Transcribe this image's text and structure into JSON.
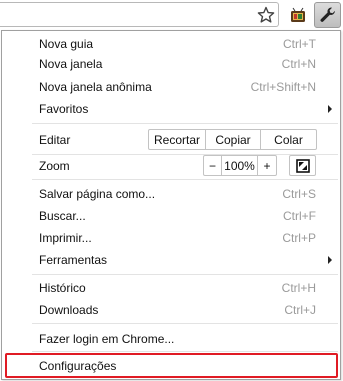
{
  "icons": {
    "star": "star-icon",
    "extension": "extension-icon",
    "wrench": "wrench-icon",
    "fullscreen": "fullscreen-icon"
  },
  "colors": {
    "highlight": "#e01b24",
    "shortcut": "#9a9a9a"
  },
  "menu": {
    "new_tab": {
      "label": "Nova guia",
      "shortcut": "Ctrl+T"
    },
    "new_window": {
      "label": "Nova janela",
      "shortcut": "Ctrl+N"
    },
    "incognito": {
      "label": "Nova janela anônima",
      "shortcut": "Ctrl+Shift+N"
    },
    "favorites": {
      "label": "Favoritos"
    },
    "edit": {
      "label": "Editar",
      "cut": "Recortar",
      "copy": "Copiar",
      "paste": "Colar"
    },
    "zoom": {
      "label": "Zoom",
      "minus": "−",
      "value": "100%",
      "plus": "+"
    },
    "save_page": {
      "label": "Salvar página como...",
      "shortcut": "Ctrl+S"
    },
    "find": {
      "label": "Buscar...",
      "shortcut": "Ctrl+F"
    },
    "print": {
      "label": "Imprimir...",
      "shortcut": "Ctrl+P"
    },
    "tools": {
      "label": "Ferramentas"
    },
    "history": {
      "label": "Histórico",
      "shortcut": "Ctrl+H"
    },
    "downloads": {
      "label": "Downloads",
      "shortcut": "Ctrl+J"
    },
    "sign_in": {
      "label": "Fazer login em Chrome..."
    },
    "settings": {
      "label": "Configurações"
    }
  }
}
